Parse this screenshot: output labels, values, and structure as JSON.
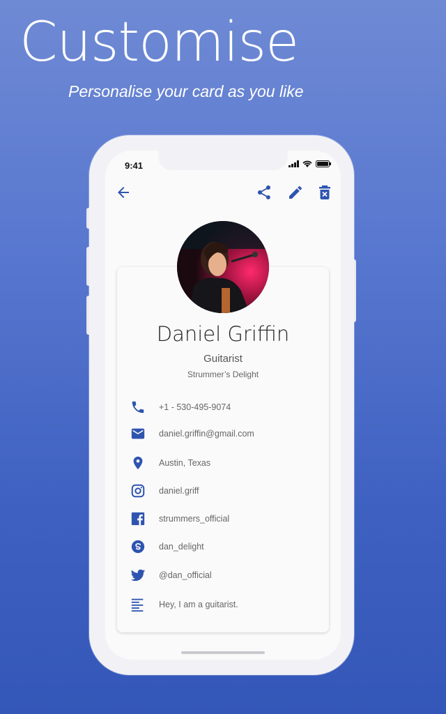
{
  "headline": "Customise",
  "subheadline": "Personalise your card as you like",
  "status_bar": {
    "time": "9:41"
  },
  "toolbar": {
    "back_icon": "arrow-left-icon",
    "share_icon": "share-icon",
    "edit_icon": "pencil-icon",
    "delete_icon": "delete-icon"
  },
  "profile": {
    "name": "Daniel Griffin",
    "title": "Guitarist",
    "company": "Strummer’s Delight"
  },
  "contacts": [
    {
      "icon": "phone-icon",
      "value": "+1 - 530-495-9074"
    },
    {
      "icon": "email-icon",
      "value": "daniel.griffin@gmail.com"
    },
    {
      "icon": "location-icon",
      "value": "Austin, Texas"
    },
    {
      "icon": "instagram-icon",
      "value": "daniel.griff"
    },
    {
      "icon": "facebook-icon",
      "value": "strummers_official"
    },
    {
      "icon": "skype-icon",
      "value": "dan_delight"
    },
    {
      "icon": "twitter-icon",
      "value": "@dan_official"
    },
    {
      "icon": "notes-icon",
      "value": "Hey, I am a guitarist."
    }
  ],
  "colors": {
    "accent": "#2f54b0",
    "background_top": "#6f8ad4",
    "background_bottom": "#3357b8"
  }
}
